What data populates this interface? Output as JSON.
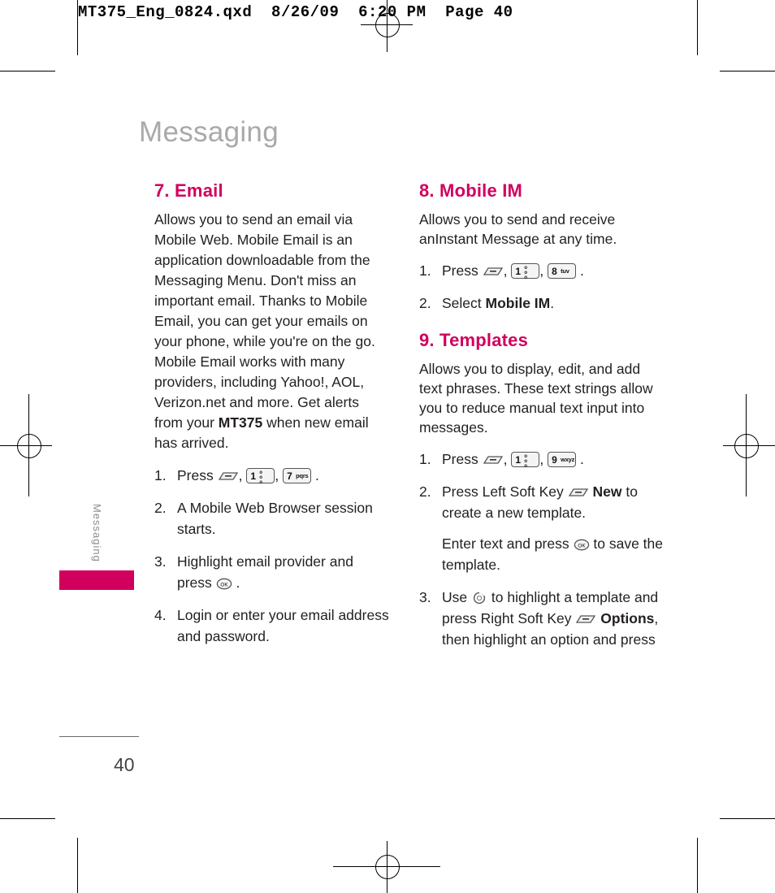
{
  "slug": "MT375_Eng_0824.qxd  8/26/09  6:20 PM  Page 40",
  "page_title": "Messaging",
  "side_tab": "Messaging",
  "folio": "40",
  "accent_color": "#d1005d",
  "title_gray": "#a9a9a9",
  "left_column": {
    "heading": "7. Email",
    "paragraph": "Allows you to send an email via Mobile Web. Mobile Email is an application downloadable from the Messaging Menu. Don't miss an important email. Thanks to Mobile Email, you can get your emails on your phone, while you're on the go. Mobile Email works with many providers, including Yahoo!, AOL, Verizon.net and more. Get alerts from your MT375 when new email has arrived.",
    "paragraph_bold_term": "MT375",
    "steps": [
      {
        "num": "1.",
        "text_before": "Press",
        "keys": [
          "menu-soft-key",
          "key-1-voicemail",
          "key-7-pqrs"
        ],
        "text_after": "."
      },
      {
        "num": "2.",
        "text_before": "A Mobile Web Browser session starts.",
        "keys": [],
        "text_after": ""
      },
      {
        "num": "3.",
        "text_before": "Highlight email provider and press",
        "keys": [
          "ok-key"
        ],
        "text_after": "."
      },
      {
        "num": "4.",
        "text_before": "Login or enter your email address and password.",
        "keys": [],
        "text_after": ""
      }
    ]
  },
  "right_column": {
    "section_mobile_im": {
      "heading": "8. Mobile IM",
      "paragraph": "Allows you to send and receive anInstant Message at any time.",
      "steps": [
        {
          "num": "1.",
          "text_before": "Press",
          "keys": [
            "menu-soft-key",
            "key-1-voicemail",
            "key-8-tuv"
          ],
          "text_after": "."
        },
        {
          "num": "2.",
          "text_before": "Select",
          "bold": "Mobile IM",
          "text_after": "."
        }
      ]
    },
    "section_templates": {
      "heading": "9. Templates",
      "paragraph": "Allows you to display, edit, and add text phrases. These text strings allow you to reduce manual text input into messages.",
      "steps": [
        {
          "num": "1.",
          "text_before": "Press",
          "keys": [
            "menu-soft-key",
            "key-1-voicemail",
            "key-9-wxyz"
          ],
          "text_after": "."
        },
        {
          "num": "2.",
          "text_before": "Press Left Soft Key",
          "bold": "New",
          "text_after": "to create a new template.",
          "sub_before": "Enter text and press",
          "sub_key": "ok-key",
          "sub_after": "to save the template."
        },
        {
          "num": "3.",
          "text_before": "Use",
          "mid_key": "navigation-key",
          "text_mid": "to highlight a template and press Right Soft Key",
          "bold": "Options",
          "text_after": ", then highlight an option and press"
        }
      ]
    }
  },
  "key_labels": {
    "key-1-voicemail": {
      "big": "1",
      "stack": [
        "o",
        "o",
        "o"
      ]
    },
    "key-7-pqrs": {
      "big": "7",
      "sml": "pqrs"
    },
    "key-8-tuv": {
      "big": "8",
      "sml": "tuv"
    },
    "key-9-wxyz": {
      "big": "9",
      "sml": "wxyz"
    },
    "ok-key": {
      "label": "OK"
    }
  }
}
